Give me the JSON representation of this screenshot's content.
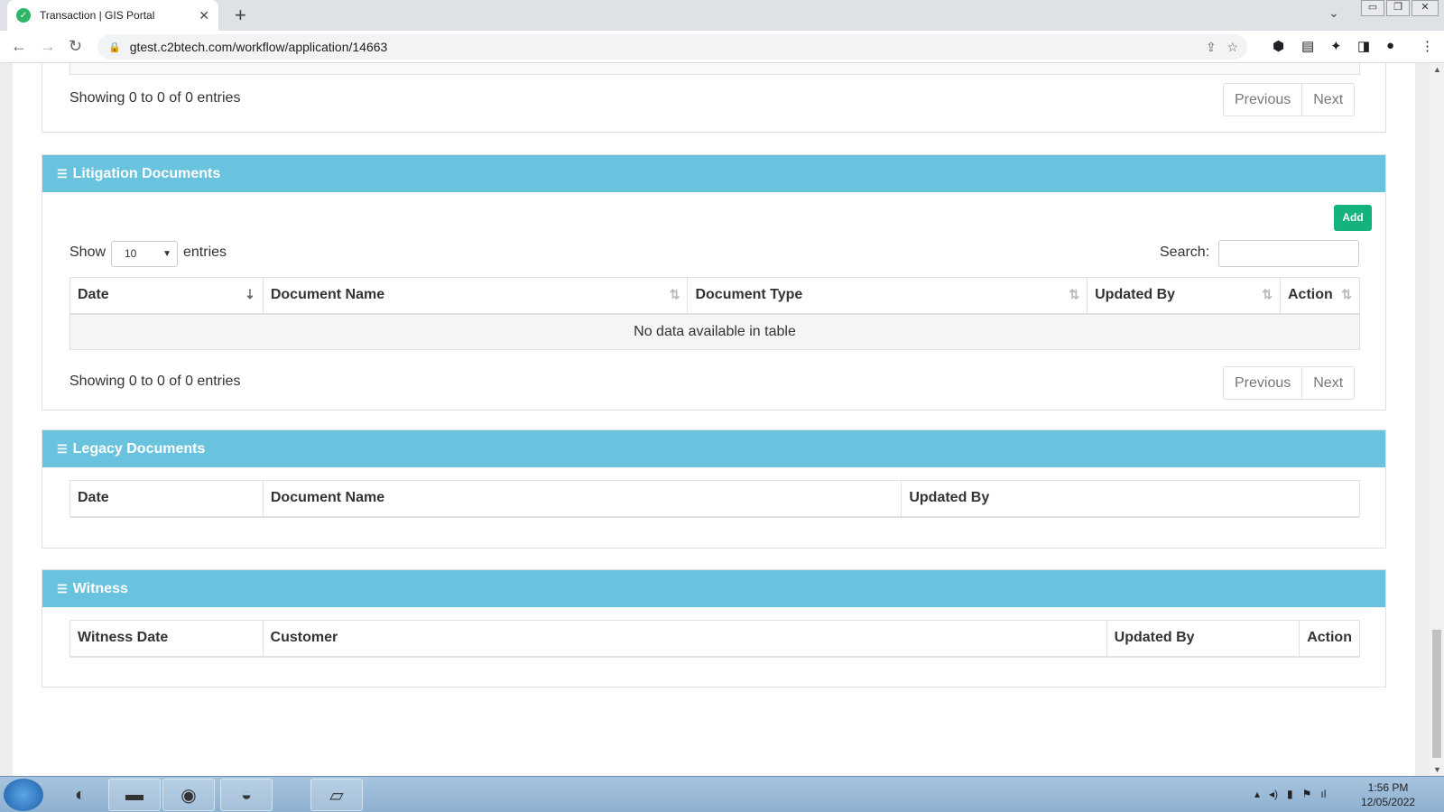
{
  "browser": {
    "tab_title": "Transaction | GIS Portal",
    "url": "gtest.c2btech.com/workflow/application/14663"
  },
  "top_section": {
    "showing": "Showing 0 to 0 of 0 entries",
    "prev": "Previous",
    "next": "Next"
  },
  "litigation": {
    "title": "Litigation Documents",
    "add": "Add",
    "show": "Show",
    "entries": "entries",
    "page_size": "10",
    "search_label": "Search:",
    "columns": [
      "Date",
      "Document Name",
      "Document Type",
      "Updated By",
      "Action"
    ],
    "empty": "No data available in table",
    "showing": "Showing 0 to 0 of 0 entries",
    "prev": "Previous",
    "next": "Next"
  },
  "legacy": {
    "title": "Legacy Documents",
    "columns": [
      "Date",
      "Document Name",
      "Updated By"
    ]
  },
  "witness": {
    "title": "Witness",
    "columns": [
      "Witness Date",
      "Customer",
      "Updated By",
      "Action"
    ]
  },
  "taskbar": {
    "time": "1:56 PM",
    "date": "12/05/2022"
  },
  "colors": {
    "panel_header": "#69c3df",
    "add_button": "#14b37d"
  }
}
